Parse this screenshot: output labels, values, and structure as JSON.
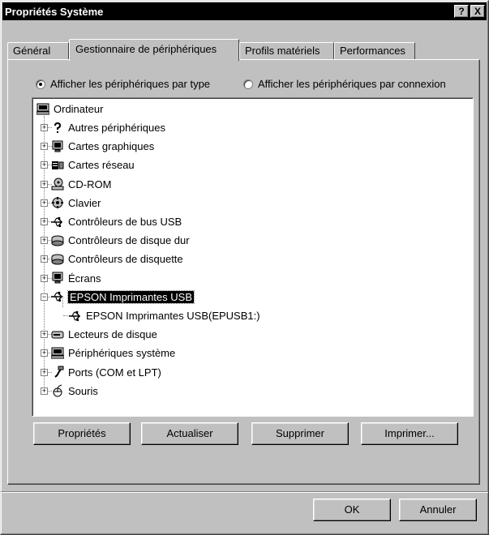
{
  "window": {
    "title": "Propriétés Système",
    "help_label": "?",
    "close_label": "X"
  },
  "tabs": [
    {
      "label": "Général",
      "active": false
    },
    {
      "label": "Gestionnaire de périphériques",
      "active": true
    },
    {
      "label": "Profils matériels",
      "active": false
    },
    {
      "label": "Performances",
      "active": false
    }
  ],
  "view_options": {
    "by_type": {
      "label": "Afficher les périphériques par type",
      "checked": true
    },
    "by_connection": {
      "label": "Afficher les périphériques par connexion",
      "checked": false
    }
  },
  "tree": {
    "root": {
      "label": "Ordinateur",
      "icon": "computer-icon"
    },
    "items": [
      {
        "label": "Autres périphériques",
        "icon": "question-icon",
        "expanded": false
      },
      {
        "label": "Cartes graphiques",
        "icon": "monitor-icon",
        "expanded": false
      },
      {
        "label": "Cartes réseau",
        "icon": "network-icon",
        "expanded": false
      },
      {
        "label": "CD-ROM",
        "icon": "cdrom-icon",
        "expanded": false
      },
      {
        "label": "Clavier",
        "icon": "keyboard-icon",
        "expanded": false
      },
      {
        "label": "Contrôleurs de bus USB",
        "icon": "usb-icon",
        "expanded": false
      },
      {
        "label": "Contrôleurs de disque dur",
        "icon": "disk-icon",
        "expanded": false
      },
      {
        "label": "Contrôleurs de disquette",
        "icon": "disk-icon",
        "expanded": false
      },
      {
        "label": "Écrans",
        "icon": "monitor-icon",
        "expanded": false
      },
      {
        "label": "EPSON Imprimantes USB",
        "icon": "usb-icon",
        "expanded": true,
        "selected": true
      },
      {
        "label": "EPSON Imprimantes USB(EPUSB1:)",
        "icon": "usb-icon",
        "child": true
      },
      {
        "label": "Lecteurs de disque",
        "icon": "drive-icon",
        "expanded": false
      },
      {
        "label": "Périphériques système",
        "icon": "computer-icon",
        "expanded": false
      },
      {
        "label": "Ports (COM et LPT)",
        "icon": "port-icon",
        "expanded": false
      },
      {
        "label": "Souris",
        "icon": "mouse-icon",
        "expanded": false
      }
    ]
  },
  "buttons": {
    "properties": "Propriétés",
    "refresh": "Actualiser",
    "remove": "Supprimer",
    "print": "Imprimer...",
    "ok": "OK",
    "cancel": "Annuler"
  }
}
